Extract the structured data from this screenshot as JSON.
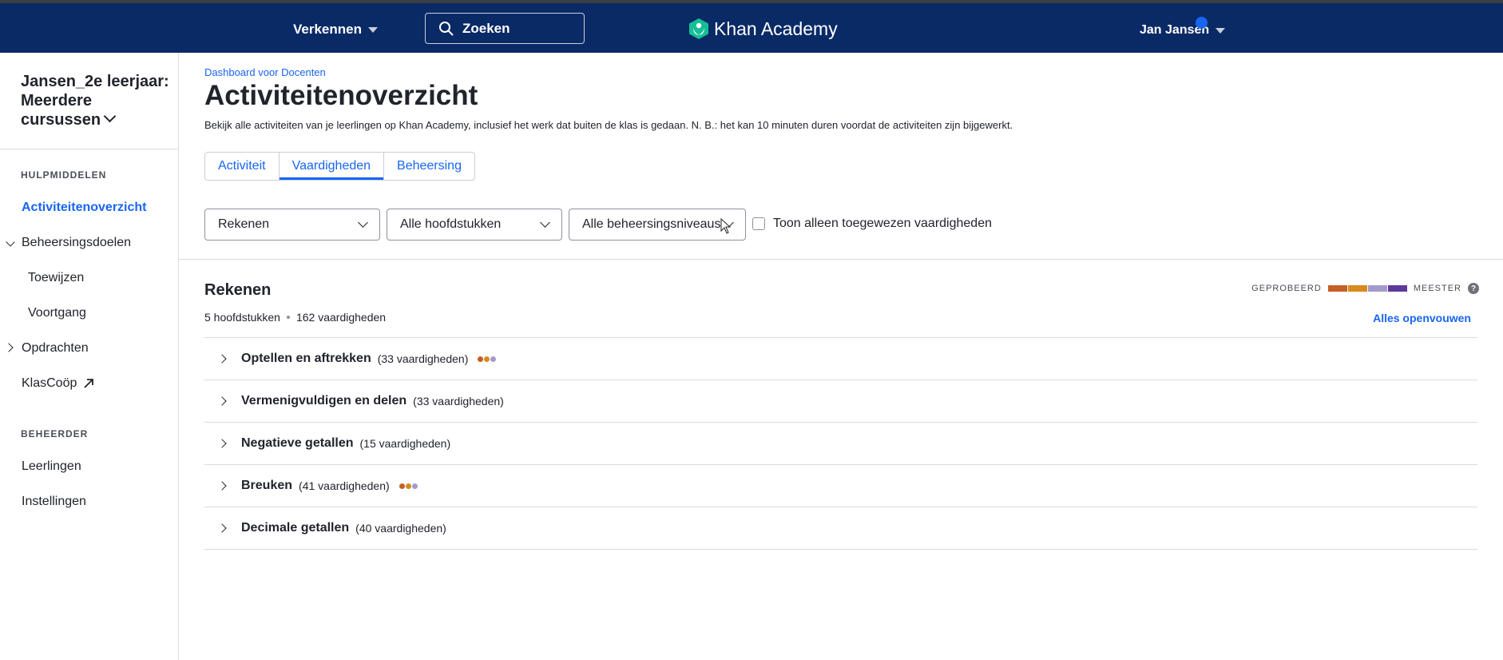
{
  "topbar": {
    "explore_label": "Verkennen",
    "search_placeholder": "Zoeken",
    "brand_name": "Khan Academy",
    "user_name": "Jan Jansen"
  },
  "sidebar": {
    "class_title": "Jansen_2e leerjaar: Meerdere cursussen",
    "section_tools": "HULPMIDDELEN",
    "items": [
      {
        "label": "Activiteitenoverzicht"
      },
      {
        "label": "Beheersingsdoelen"
      },
      {
        "label": "Toewijzen"
      },
      {
        "label": "Voortgang"
      },
      {
        "label": "Opdrachten"
      },
      {
        "label": "KlasCoöp"
      }
    ],
    "section_admin": "BEHEERDER",
    "admin_items": [
      {
        "label": "Leerlingen"
      },
      {
        "label": "Instellingen"
      }
    ]
  },
  "main": {
    "breadcrumb": "Dashboard voor Docenten",
    "title": "Activiteitenoverzicht",
    "description": "Bekijk alle activiteiten van je leerlingen op Khan Academy, inclusief het werk dat buiten de klas is gedaan. N. B.: het kan 10 minuten duren voordat de activiteiten zijn bijgewerkt.",
    "tabs": [
      {
        "label": "Activiteit"
      },
      {
        "label": "Vaardigheden"
      },
      {
        "label": "Beheersing"
      }
    ],
    "filters": {
      "course": "Rekenen",
      "units": "Alle hoofdstukken",
      "mastery": "Alle beheersingsniveaus",
      "only_assigned_label": "Toon alleen toegewezen vaardigheden"
    },
    "course_title": "Rekenen",
    "legend_left": "GEPROBEERD",
    "legend_right": "MEESTER",
    "legend_help": "?",
    "unit_count": "5 hoofdstukken",
    "skill_count": "162 vaardigheden",
    "expand_all": "Alles openvouwen",
    "units": [
      {
        "name": "Optellen en aftrekken",
        "count": "(33 vaardigheden)"
      },
      {
        "name": "Vermenigvuldigen en delen",
        "count": "(33 vaardigheden)"
      },
      {
        "name": "Negatieve getallen",
        "count": "(15 vaardigheden)"
      },
      {
        "name": "Breuken",
        "count": "(41 vaardigheden)"
      },
      {
        "name": "Decimale getallen",
        "count": "(40 vaardigheden)"
      }
    ]
  },
  "colors": {
    "topbar": "#0a2a66",
    "link": "#1865f2",
    "attempted": "#c65f25",
    "familiar": "#d88a1d",
    "proficient": "#a29bc9",
    "mastered": "#5b3a9b"
  }
}
